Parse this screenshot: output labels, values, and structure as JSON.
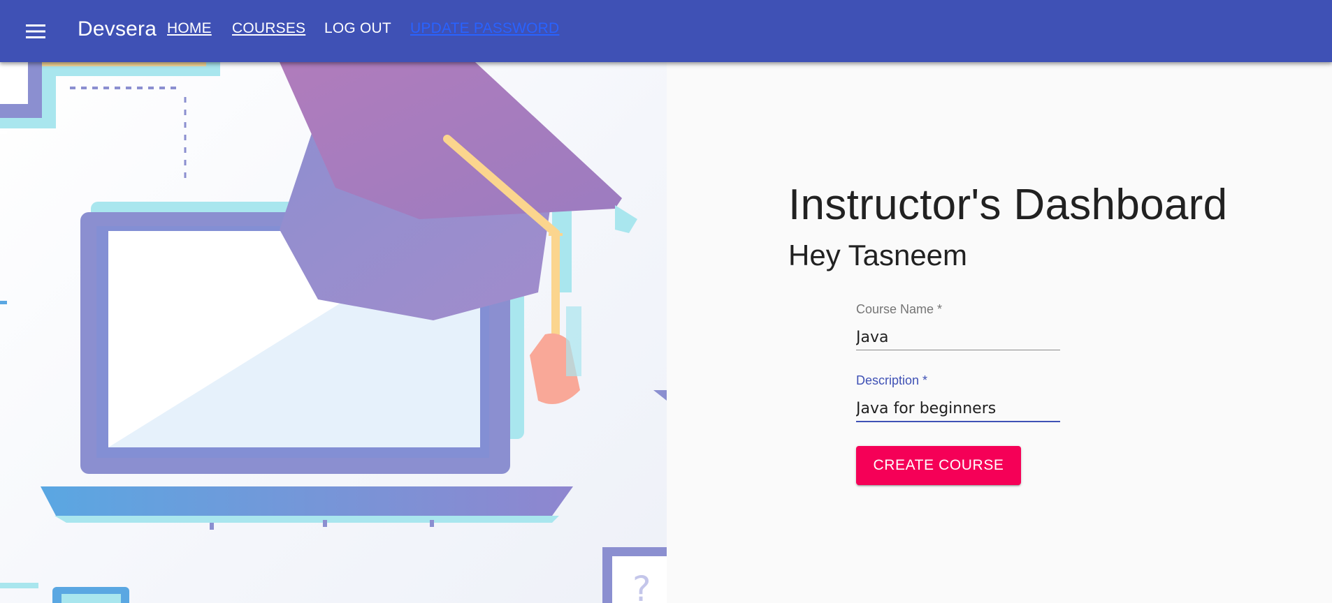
{
  "appbar": {
    "menu_icon": "hamburger-menu-icon",
    "brand": "Devsera",
    "nav": {
      "home": "HOME",
      "courses": "COURSES",
      "logout": "LOG OUT",
      "update_password": "UPDATE PASSWORD"
    },
    "color": "#3f51b5"
  },
  "hero": {
    "illustration": "laptop-graduation-cap-illustration"
  },
  "main": {
    "title": "Instructor's Dashboard",
    "greeting": "Hey Tasneem",
    "form": {
      "course_name": {
        "label": "Course Name *",
        "value": "Java"
      },
      "description": {
        "label": "Description *",
        "value": "Java for beginners"
      },
      "submit_label": "CREATE COURSE",
      "submit_color": "#f50057"
    }
  }
}
